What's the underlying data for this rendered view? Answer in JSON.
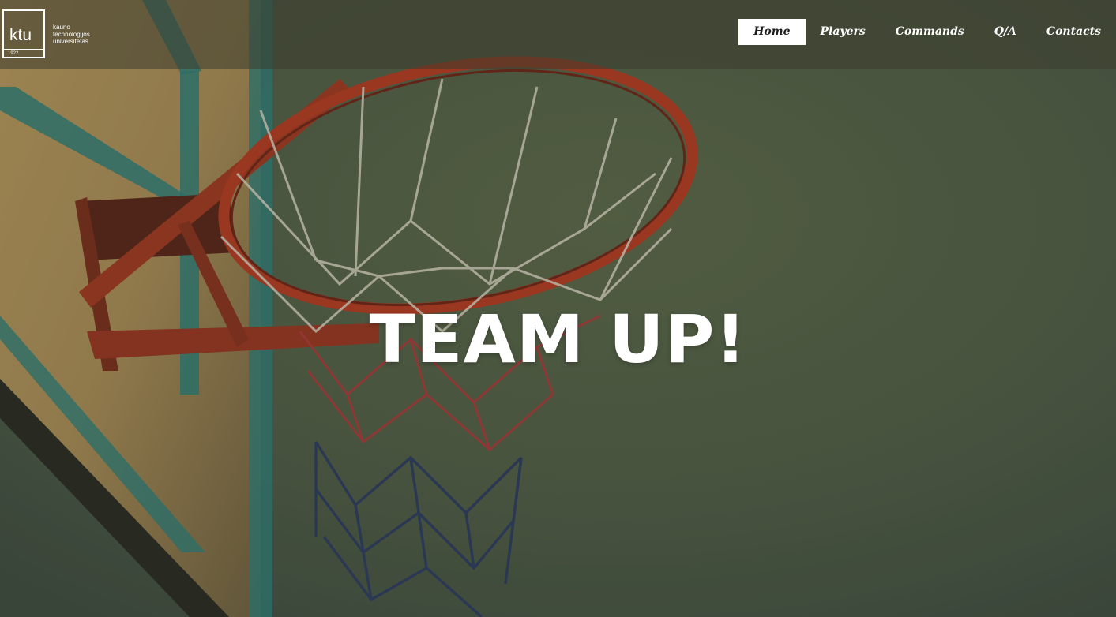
{
  "logo": {
    "acronym": "ktu",
    "year": "1922",
    "name_lines": [
      "kauno",
      "technologijos",
      "universitetas"
    ]
  },
  "nav": {
    "items": [
      {
        "label": "Home",
        "active": true
      },
      {
        "label": "Players",
        "active": false
      },
      {
        "label": "Commands",
        "active": false
      },
      {
        "label": "Q/A",
        "active": false
      },
      {
        "label": "Contacts",
        "active": false
      }
    ]
  },
  "hero": {
    "title": "TEAM UP!"
  },
  "colors": {
    "navbar_overlay": "#3c3c2d",
    "active_nav_bg": "#ffffff",
    "text": "#ffffff",
    "sky": "#56604a",
    "rim": "#b53a22",
    "backboard": "#c9a96b",
    "backboard_stripe": "#2f7d78"
  }
}
